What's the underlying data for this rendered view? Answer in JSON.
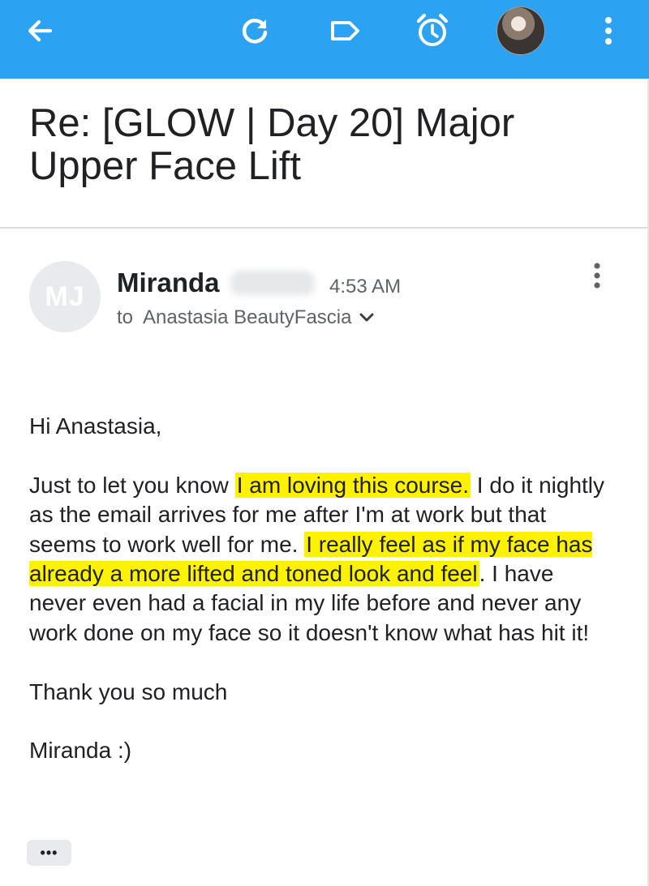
{
  "appbar": {
    "background": "#2ba3f2",
    "icons": [
      "back-arrow-icon",
      "refresh-icon",
      "label-icon",
      "snooze-alarm-icon",
      "account-avatar",
      "more-vert-icon"
    ]
  },
  "email": {
    "subject": "Re: [GLOW | Day 20] Major Upper Face Lift",
    "sender_initials": "MJ",
    "sender_name": "Miranda",
    "time": "4:53 AM",
    "to_label": "to",
    "recipient": "Anastasia BeautyFascia",
    "body": {
      "greeting": "Hi Anastasia,",
      "p1_a": "Just to let you know ",
      "p1_highlight1": "I am loving this course.",
      "p1_b": " I do it nightly as the email arrives for me after I'm at work but that seems to work well for me. ",
      "p1_highlight2": "I really feel as if my face has already a more lifted and toned look and feel",
      "p1_c": ". I have never even had a facial in my life before and never any work done on my face so it doesn't know what has hit it!",
      "thanks": "Thank you so much",
      "signoff": "Miranda :)"
    },
    "highlight_color": "#fff200",
    "trimmed_content_label": "•••"
  }
}
